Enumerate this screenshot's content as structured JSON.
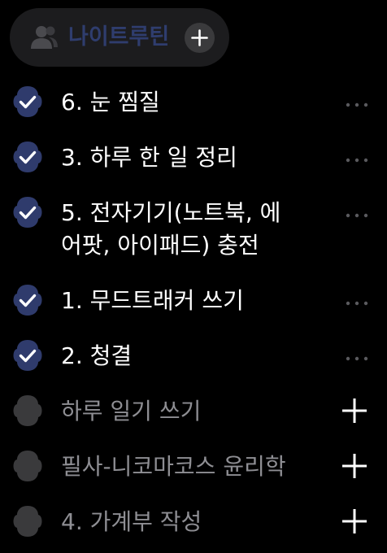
{
  "routine": {
    "title": "나이트루틴",
    "icon": "people-icon",
    "add_icon": "plus-icon"
  },
  "colors": {
    "background": "#000000",
    "chip_background": "#1c1c1e",
    "chip_title": "#2f3d6e",
    "done_badge": "#2f3b6c",
    "pending_badge": "#3a3a3c",
    "done_text": "#ffffff",
    "pending_text": "#8e8e93",
    "more_dots": "#5a5a5e"
  },
  "tasks": [
    {
      "label": "6. 눈 찜질",
      "done": true
    },
    {
      "label": "3. 하루 한 일 정리",
      "done": true
    },
    {
      "label": "5. 전자기기(노트북, 에\n어팟, 아이패드) 충전",
      "done": true
    },
    {
      "label": "1. 무드트래커 쓰기",
      "done": true
    },
    {
      "label": "2. 청결",
      "done": true
    },
    {
      "label": "하루 일기 쓰기",
      "done": false
    },
    {
      "label": "필사-니코마코스 윤리학",
      "done": false
    },
    {
      "label": "4. 가계부 작성",
      "done": false
    }
  ]
}
